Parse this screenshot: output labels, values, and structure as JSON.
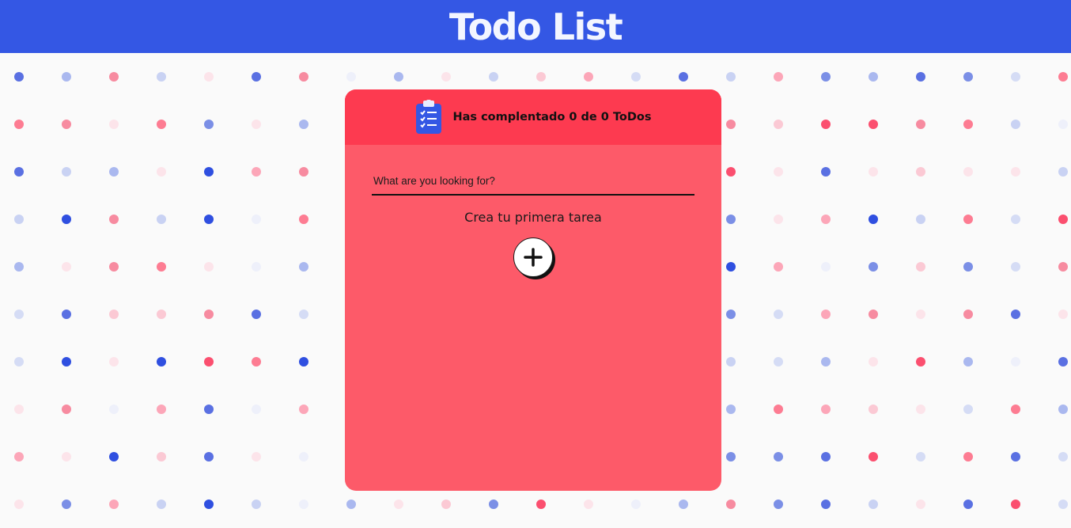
{
  "header": {
    "title": "Todo List"
  },
  "card": {
    "counter": {
      "prefix": "Has complentado",
      "completed": "0",
      "middle": "de",
      "total": "0",
      "suffix": "ToDos"
    },
    "search": {
      "placeholder": "What are you looking for?",
      "value": ""
    },
    "empty_message": "Crea tu primera tarea",
    "add_button_icon": "plus-icon",
    "header_icon": "clipboard-checklist-icon"
  },
  "colors": {
    "header_bg": "#3457e4",
    "card_bg": "#fd5a69",
    "card_head_bg": "#fd3a50",
    "page_bg": "#fafafa"
  }
}
